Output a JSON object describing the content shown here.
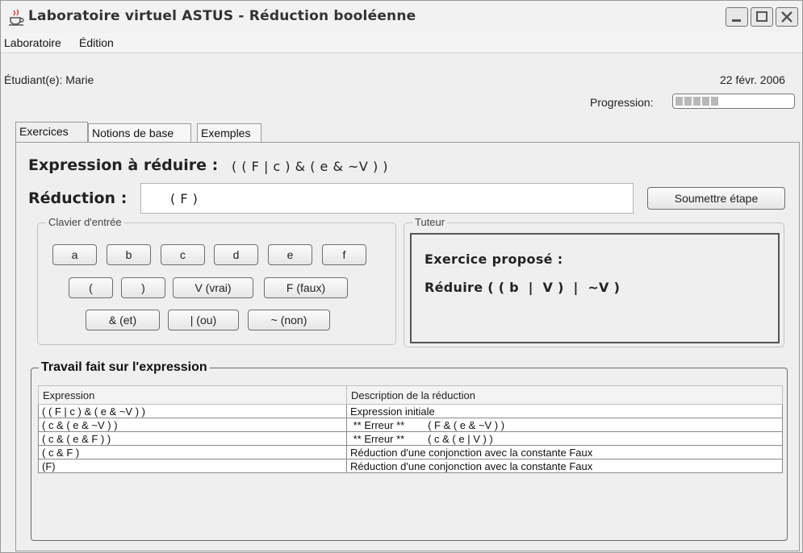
{
  "window": {
    "title": "Laboratoire virtuel ASTUS - Réduction booléenne",
    "icon": "java-cup-icon"
  },
  "menu": [
    "Laboratoire",
    "Édition"
  ],
  "header": {
    "student": "Étudiant(e): Marie",
    "date": "22 févr. 2006",
    "progress_label": "Progression:",
    "progress_segments_filled": 5
  },
  "tabs": [
    {
      "label": "Exercices",
      "active": true
    },
    {
      "label": "Notions de base",
      "active": false
    },
    {
      "label": "Exemples",
      "active": false
    }
  ],
  "exercise": {
    "expression_label": "Expression à réduire :",
    "expression_value": "( ( F | c ) & ( e & ~V ) )",
    "reduction_label": "Réduction :",
    "reduction_value": "( F )",
    "submit_label": "Soumettre étape"
  },
  "keyboard": {
    "legend": "Clavier d'entrée",
    "row1": [
      "a",
      "b",
      "c",
      "d",
      "e",
      "f"
    ],
    "row2": [
      "(",
      ")",
      "V (vrai)",
      "F (faux)"
    ],
    "row3": [
      "& (et)",
      "| (ou)",
      "~ (non)"
    ]
  },
  "tutor": {
    "legend": "Tuteur",
    "line1": "Exercice proposé :",
    "line2": "Réduire ( ( b  |  V )  |  ~V )"
  },
  "work": {
    "legend": "Travail fait sur l'expression",
    "columns": [
      "Expression",
      "Description de la réduction"
    ],
    "rows": [
      [
        "( ( F | c ) & ( e & ~V ) )",
        "Expression initiale"
      ],
      [
        "( c & ( e & ~V ) )",
        " ** Erreur **        ( F & ( e & ~V ) )"
      ],
      [
        "( c & ( e & F ) )",
        " ** Erreur **        ( c & ( e | V ) )"
      ],
      [
        "( c & F )",
        "Réduction d'une conjonction avec la constante Faux"
      ],
      [
        "(F)",
        "Réduction d'une conjonction avec la constante Faux"
      ]
    ]
  }
}
